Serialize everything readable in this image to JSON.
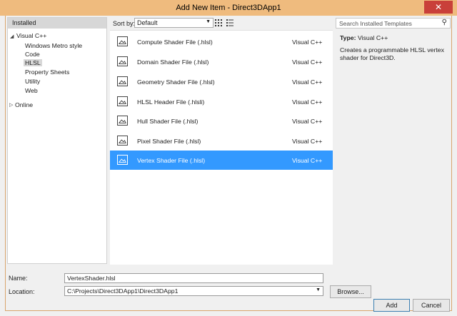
{
  "window": {
    "title": "Add New Item - Direct3DApp1",
    "close_glyph": "✕"
  },
  "left_pane": {
    "header": "Installed",
    "tree": [
      {
        "label": "Visual C++"
      },
      {
        "label": "Windows Metro style"
      },
      {
        "label": "Code"
      },
      {
        "label": "HLSL"
      },
      {
        "label": "Property Sheets"
      },
      {
        "label": "Utility"
      },
      {
        "label": "Web"
      },
      {
        "label": "Online"
      }
    ],
    "selected": "HLSL"
  },
  "toolbar": {
    "sort_label": "Sort by:",
    "sort_value": "Default",
    "views": [
      "grid-view-icon",
      "list-view-icon"
    ]
  },
  "templates": [
    {
      "name": "Compute Shader File (.hlsl)",
      "lang": "Visual C++"
    },
    {
      "name": "Domain Shader File (.hlsl)",
      "lang": "Visual C++"
    },
    {
      "name": "Geometry Shader File (.hlsl)",
      "lang": "Visual C++"
    },
    {
      "name": "HLSL Header File (.hlsli)",
      "lang": "Visual C++"
    },
    {
      "name": "Hull Shader File (.hlsl)",
      "lang": "Visual C++"
    },
    {
      "name": "Pixel Shader File (.hlsl)",
      "lang": "Visual C++"
    },
    {
      "name": "Vertex Shader File (.hlsl)",
      "lang": "Visual C++"
    }
  ],
  "selected_template": "Vertex Shader File (.hlsl)",
  "search": {
    "placeholder": "Search Installed Templates",
    "icon": "search-icon"
  },
  "details": {
    "type_label": "Type:",
    "type_value": "Visual C++",
    "description": "Creates a programmable HLSL vertex shader for Direct3D."
  },
  "form": {
    "name_label": "Name:",
    "name_value": "VertexShader.hlsl",
    "location_label": "Location:",
    "location_value": "C:\\Projects\\Direct3DApp1\\Direct3DApp1",
    "browse_label": "Browse...",
    "add_label": "Add",
    "cancel_label": "Cancel"
  },
  "colors": {
    "title_bar": "#efbb7e",
    "selection": "#3399ff",
    "close_button": "#c9403a"
  }
}
